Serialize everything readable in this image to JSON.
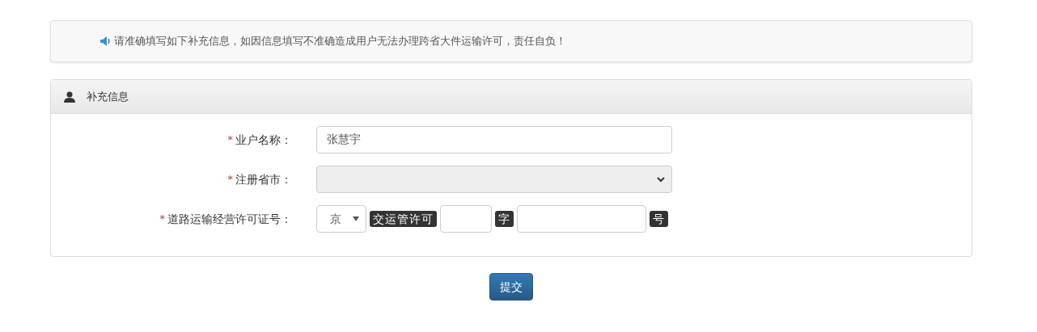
{
  "notice": {
    "text": "请准确填写如下补充信息，如因信息填写不准确造成用户无法办理跨省大件运输许可，责任自负！"
  },
  "panel": {
    "title": "补充信息"
  },
  "fields": [
    {
      "kind": "text",
      "required_mark": "*",
      "label": "业户名称：",
      "value": "张慧宇"
    },
    {
      "kind": "select",
      "required_mark": "*",
      "label": "注册省市：",
      "disabled": true
    },
    {
      "kind": "permit",
      "required_mark": "*",
      "label": "道路运输经营许可证号：",
      "parts": [
        {
          "kind": "select",
          "value": "京"
        },
        {
          "kind": "tag",
          "text": "交运管许可"
        },
        {
          "kind": "short-input"
        },
        {
          "kind": "tag",
          "text": "字"
        },
        {
          "kind": "long-input"
        },
        {
          "kind": "tag",
          "text": "号"
        }
      ]
    }
  ],
  "submit": {
    "label": "提交"
  }
}
